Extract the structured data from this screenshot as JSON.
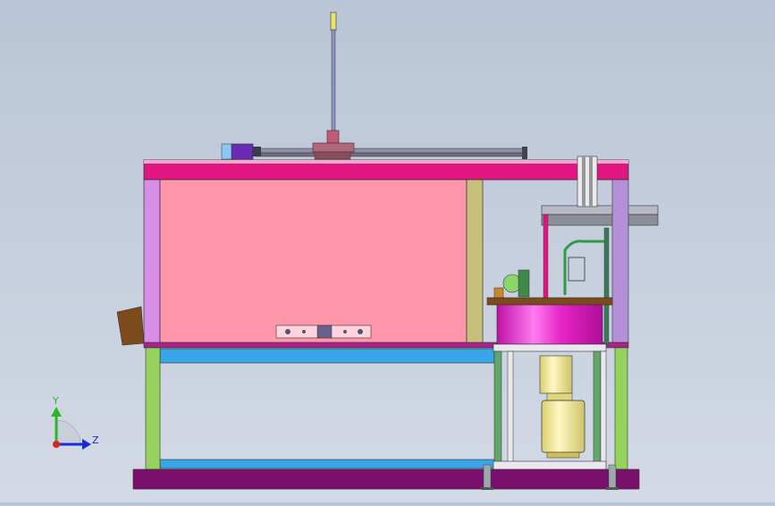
{
  "viewport": {
    "background_top": "#b9c5d6",
    "background_bottom": "#d3dae5"
  },
  "triad": {
    "y_label": "Y",
    "z_label": "Z",
    "y_color": "#22bb22",
    "z_color": "#1a2ad8",
    "x_color": "#dd2222"
  },
  "colors": {
    "top_beam": "#e0157f",
    "left_panel": "#d88ee6",
    "main_panel": "#ff97ab",
    "right_post": "#c6c07a",
    "mid_beam": "#a8238a",
    "blue_rail": "#3aa4e8",
    "green_leg": "#96d35c",
    "base": "#7a0f6e",
    "tank": "#e826c8",
    "motor": "#f0e79b",
    "bracket": "#7d4a1c",
    "servo": "#6a2cb8"
  },
  "components": [
    "vertical-rod",
    "linear-rail",
    "servo-motor",
    "top-beam",
    "main-panel",
    "control-plate",
    "lift-column",
    "mixing-tank",
    "gear-motor",
    "base-frame"
  ]
}
